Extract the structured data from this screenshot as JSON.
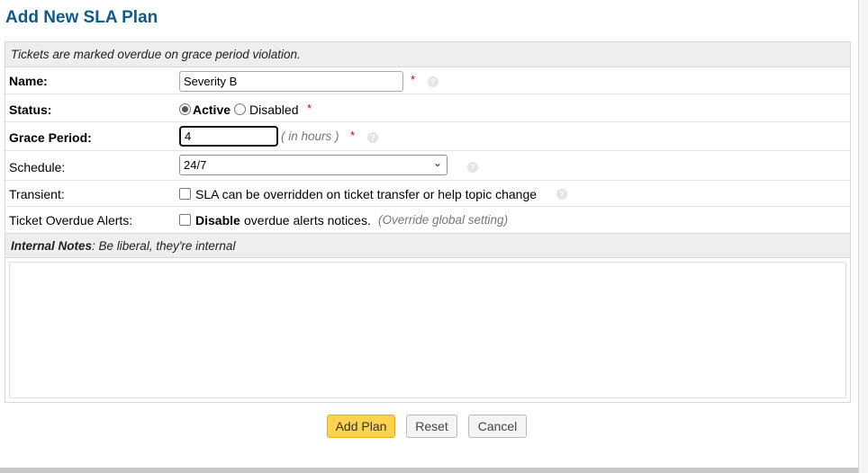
{
  "page": {
    "title": "Add New SLA Plan"
  },
  "form": {
    "notice": "Tickets are marked overdue on grace period violation.",
    "name": {
      "label": "Name:",
      "value": "Severity B",
      "required_mark": "*"
    },
    "status": {
      "label": "Status:",
      "options": [
        {
          "label": "Active",
          "checked": true
        },
        {
          "label": "Disabled",
          "checked": false
        }
      ],
      "required_mark": "*"
    },
    "grace_period": {
      "label": "Grace Period:",
      "value": "4",
      "hint": "( in hours )",
      "required_mark": "*"
    },
    "schedule": {
      "label": "Schedule:",
      "selected": "24/7"
    },
    "transient": {
      "label": "Transient:",
      "checkbox_label": "SLA can be overridden on ticket transfer or help topic change",
      "checked": false
    },
    "overdue_alerts": {
      "label": "Ticket Overdue Alerts:",
      "checkbox_bold": "Disable",
      "checkbox_label": "overdue alerts notices.",
      "hint": "(Override global setting)",
      "checked": false
    },
    "internal_notes": {
      "title": "Internal Notes",
      "subtitle": ": Be liberal, they're internal",
      "value": ""
    }
  },
  "buttons": {
    "add": "Add Plan",
    "reset": "Reset",
    "cancel": "Cancel"
  },
  "icons": {
    "help": "help-circle-icon",
    "dropdown": "chevron-down-icon"
  },
  "colors": {
    "title": "#0e5a8a",
    "required": "#e00000",
    "primary_button": "#ffd351"
  }
}
